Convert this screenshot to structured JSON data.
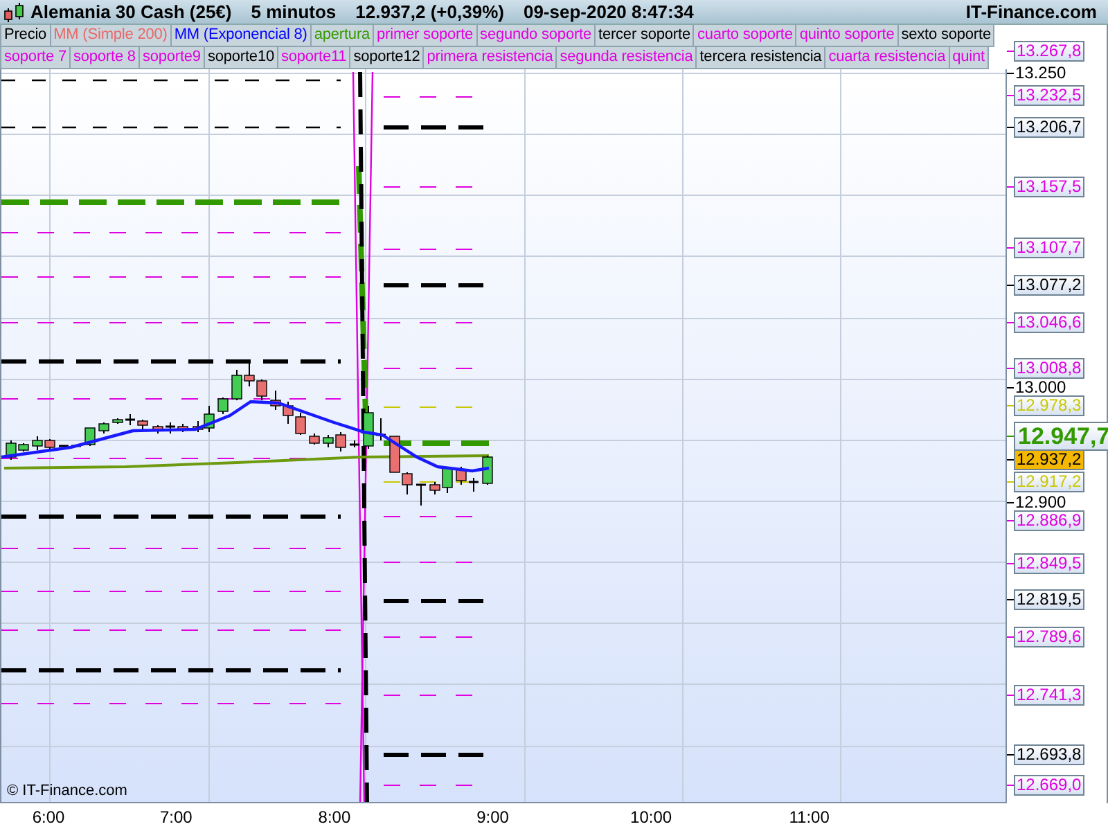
{
  "header": {
    "title": "Alemania 30 Cash (25€)",
    "interval": "5 minutos",
    "quote": "12.937,2 (+0,39%)",
    "datetime": "09-sep-2020 8:47:34",
    "brand": "IT-Finance.com"
  },
  "legend_rows": [
    [
      {
        "label": "Precio",
        "color": "#000000"
      },
      {
        "label": "MM (Simple 200)",
        "color": "#e86868"
      },
      {
        "label": "MM (Exponencial 8)",
        "color": "#0000ff"
      },
      {
        "label": "apertura",
        "color": "#339900"
      },
      {
        "label": "primer soporte",
        "color": "#e000e0"
      },
      {
        "label": "segundo soporte",
        "color": "#e000e0"
      },
      {
        "label": "tercer soporte",
        "color": "#000000"
      },
      {
        "label": "cuarto soporte",
        "color": "#e000e0"
      },
      {
        "label": "quinto soporte",
        "color": "#e000e0"
      },
      {
        "label": "sexto soporte",
        "color": "#000000"
      }
    ],
    [
      {
        "label": "soporte 7",
        "color": "#e000e0"
      },
      {
        "label": "soporte 8",
        "color": "#e000e0"
      },
      {
        "label": "soporte9",
        "color": "#e000e0"
      },
      {
        "label": "soporte10",
        "color": "#000000"
      },
      {
        "label": "soporte11",
        "color": "#e000e0"
      },
      {
        "label": "soporte12",
        "color": "#000000"
      },
      {
        "label": "primera resistencia",
        "color": "#e000e0"
      },
      {
        "label": "segunda resistencia",
        "color": "#e000e0"
      },
      {
        "label": "tercera resistencia",
        "color": "#000000"
      },
      {
        "label": "cuarta resistencia",
        "color": "#e000e0"
      },
      {
        "label": "quint",
        "color": "#e000e0"
      }
    ]
  ],
  "price_axis": [
    {
      "label": "13.267,8",
      "kind": "level",
      "color": "#e000e0"
    },
    {
      "label": "13.250",
      "kind": "tick",
      "color": "#000000"
    },
    {
      "label": "13.232,5",
      "kind": "level",
      "color": "#e000e0"
    },
    {
      "label": "13.206,7",
      "kind": "level",
      "color": "#000000"
    },
    {
      "label": "13.157,5",
      "kind": "level",
      "color": "#e000e0"
    },
    {
      "label": "13.107,7",
      "kind": "level",
      "color": "#e000e0"
    },
    {
      "label": "13.077,2",
      "kind": "level",
      "color": "#000000"
    },
    {
      "label": "13.046,6",
      "kind": "level",
      "color": "#e000e0"
    },
    {
      "label": "13.008,8",
      "kind": "level",
      "color": "#e000e0"
    },
    {
      "label": "13.000",
      "kind": "tick",
      "color": "#000000"
    },
    {
      "label": "12.978,3",
      "kind": "level",
      "color": "#c8c800"
    },
    {
      "label": "12.947,7",
      "kind": "last",
      "color": "#339900"
    },
    {
      "label": "12.937,2",
      "kind": "current",
      "color": "#f5b800"
    },
    {
      "label": "12.917,2",
      "kind": "level",
      "color": "#c8c800"
    },
    {
      "label": "12.900",
      "kind": "tick",
      "color": "#000000"
    },
    {
      "label": "12.886,9",
      "kind": "level",
      "color": "#e000e0"
    },
    {
      "label": "12.849,5",
      "kind": "level",
      "color": "#e000e0"
    },
    {
      "label": "12.819,5",
      "kind": "level",
      "color": "#000000"
    },
    {
      "label": "12.789,6",
      "kind": "level",
      "color": "#e000e0"
    },
    {
      "label": "12.741,3",
      "kind": "level",
      "color": "#e000e0"
    },
    {
      "label": "12.693,8",
      "kind": "level",
      "color": "#000000"
    },
    {
      "label": "12.669,0",
      "kind": "level",
      "color": "#e000e0"
    }
  ],
  "time_axis": [
    "6:00",
    "7:00",
    "8:00",
    "9:00",
    "10:00",
    "11:00"
  ],
  "credit": "© IT-Finance.com"
}
